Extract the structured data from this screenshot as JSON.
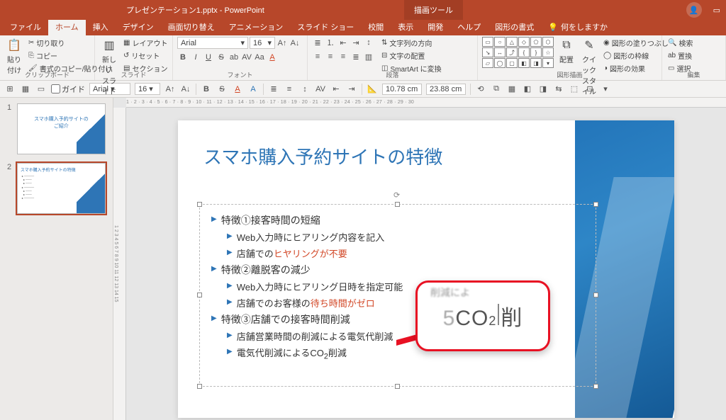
{
  "app": {
    "title": "プレゼンテーション1.pptx  -  PowerPoint",
    "context_tab": "描画ツール"
  },
  "tabs": {
    "file": "ファイル",
    "home": "ホーム",
    "insert": "挿入",
    "design": "デザイン",
    "transitions": "画面切り替え",
    "animations": "アニメーション",
    "slideshow": "スライド ショー",
    "review": "校閲",
    "view": "表示",
    "developer": "開発",
    "help": "ヘルプ",
    "format": "図形の書式",
    "tellme": "何をしますか"
  },
  "ribbon": {
    "clipboard": {
      "paste": "貼り付け",
      "cut": "切り取り",
      "copy": "コピー",
      "formatpainter": "書式のコピー/貼り付け",
      "label": "クリップボード"
    },
    "slides": {
      "new": "新しい\nスライド",
      "layout": "レイアウト",
      "reset": "リセット",
      "section": "セクション",
      "label": "スライド"
    },
    "font": {
      "name": "Arial",
      "size": "16",
      "label": "フォント"
    },
    "paragraph": {
      "textdir": "文字列の方向",
      "align": "文字の配置",
      "smartart": "SmartArt に変換",
      "label": "段落"
    },
    "drawing": {
      "arrange": "配置",
      "quickstyle": "クイック\nスタイル",
      "fill": "図形の塗りつぶし",
      "outline": "図形の枠線",
      "effects": "図形の効果",
      "label": "図形描画"
    },
    "editing": {
      "find": "検索",
      "replace": "置換",
      "select": "選択",
      "label": "編集"
    }
  },
  "toolbar2": {
    "guide": "ガイド",
    "font": "Arial",
    "size": "16",
    "width": "10.78 cm",
    "height": "23.88 cm"
  },
  "thumbs": {
    "s1_title": "スマホ購入予約サイトの\nご紹介",
    "s2_title": "スマホ購入予約サイトの特徴"
  },
  "slide": {
    "title": "スマホ購入予約サイトの特徴",
    "b1": "特徴①接客時間の短縮",
    "b1a": "Web入力時にヒアリング内容を記入",
    "b1b_pre": "店舗での",
    "b1b_accent": "ヒヤリングが不要",
    "b2": "特徴②離脱客の減少",
    "b2a": "Web入力時にヒアリング日時を指定可能",
    "b2b_pre": "店舗でのお客様の",
    "b2b_accent": "待ち時間がゼロ",
    "b3": "特徴③店舗での接客時間削減",
    "b3a": "店舗営業時間の削減による電気代削減",
    "b3b_pre": "電気代削減によるCO",
    "b3b_sub": "2",
    "b3b_post": "削減"
  },
  "callout": {
    "blur_top": "削減によ",
    "left": "5",
    "co": "CO",
    "sub": "2",
    "right": "削"
  },
  "ruler_h": "1 · 2 · 3 · 4 · 5 · 6 · 7 · 8 · 9 · 10 · 11 · 12 · 13 · 14 · 15 · 16 · 17 · 18 · 19 · 20 · 21 · 22 · 23 · 24 · 25 · 26 · 27 · 28 · 29 · 30",
  "ruler_v": "1 2 3 4 5 6 7 8 9 10 11 12 13 14 15"
}
